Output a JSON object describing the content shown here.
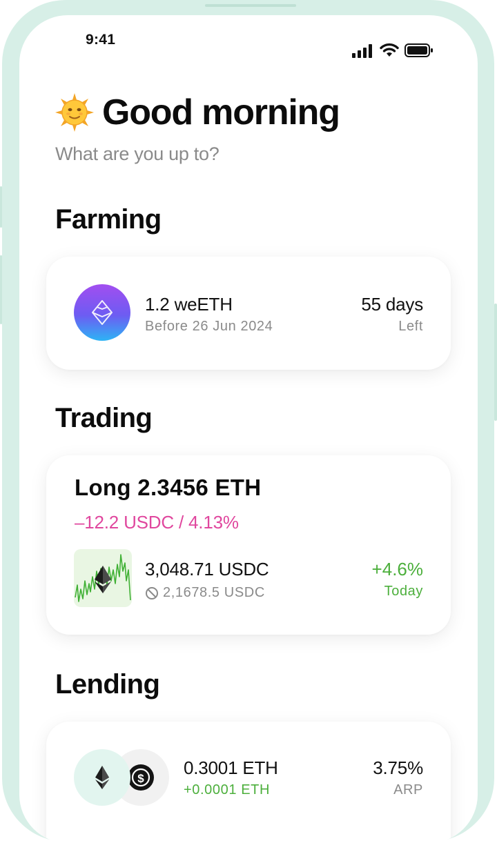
{
  "status_bar": {
    "time": "9:41",
    "icons": [
      "signal-icon",
      "wifi-icon",
      "battery-icon"
    ]
  },
  "header": {
    "emoji": "sun-with-face-icon",
    "greeting": "Good morning",
    "subtitle": "What are you up to?"
  },
  "farming": {
    "title": "Farming",
    "card": {
      "icon": "weeth-token-icon",
      "amount": "1.2 weETH",
      "date": "Before 26 Jun 2024",
      "days": "55 days",
      "days_label": "Left"
    }
  },
  "trading": {
    "title": "Trading",
    "card": {
      "position": "Long 2.3456 ETH",
      "pnl": "–12.2 USDC / 4.13%",
      "chart_icon": "eth-price-sparkline",
      "price": "3,048.71 USDC",
      "liquidation": "2,1678.5 USDC",
      "change": "+4.6%",
      "change_label": "Today"
    }
  },
  "lending": {
    "title": "Lending",
    "card": {
      "icons": [
        "eth-icon",
        "usdc-icon"
      ],
      "amount": "0.3001 ETH",
      "earned": "+0.0001 ETH",
      "rate": "3.75%",
      "rate_label": "ARP"
    }
  },
  "colors": {
    "pink": "#e0479e",
    "green": "#4caf3c",
    "frame": "#d7efe7"
  }
}
